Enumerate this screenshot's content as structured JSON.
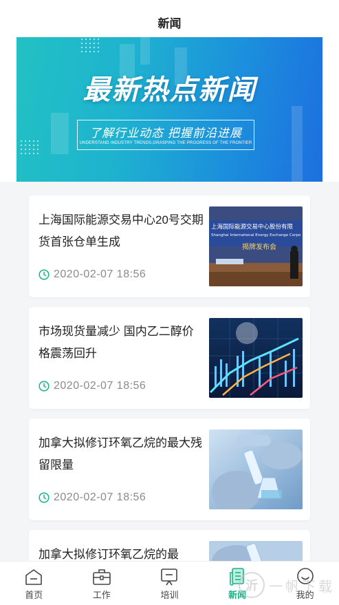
{
  "header": {
    "title": "新闻"
  },
  "banner": {
    "title": "最新热点新闻",
    "subtitle": "了解行业动态 把握前沿进展",
    "subtitle_en": "UNDERSTAND INDUSTRY TRENDS,GRASPING THE PROGRESS OF THE FRONTIER"
  },
  "news": [
    {
      "headline": "上海国际能源交易中心20号交期货首张仓单生成",
      "time": "2020-02-07 18:56",
      "thumb": {
        "line1": "上海国际能源交易中心股份有限",
        "line2": "Shanghai International Energy Exchange Corpo",
        "line3": "揭牌发布会"
      }
    },
    {
      "headline": "市场现货量减少 国内乙二醇价格震荡回升",
      "time": "2020-02-07 18:56"
    },
    {
      "headline": "加拿大拟修订环氧乙烷的最大残留限量",
      "time": "2020-02-07 18:56"
    },
    {
      "headline": "加拿大拟修订环氧乙烷的最",
      "time": ""
    }
  ],
  "tabbar": {
    "items": [
      {
        "label": "首页",
        "icon": "home-icon"
      },
      {
        "label": "工作",
        "icon": "briefcase-icon"
      },
      {
        "label": "培训",
        "icon": "training-icon"
      },
      {
        "label": "新闻",
        "icon": "news-icon",
        "active": true
      },
      {
        "label": "我的",
        "icon": "profile-icon"
      }
    ]
  },
  "watermark": {
    "glyph": "沂",
    "text": "一帆下载"
  },
  "colors": {
    "accent": "#19b388",
    "banner_start": "#22c1c4",
    "banner_end": "#1d6fdf"
  }
}
